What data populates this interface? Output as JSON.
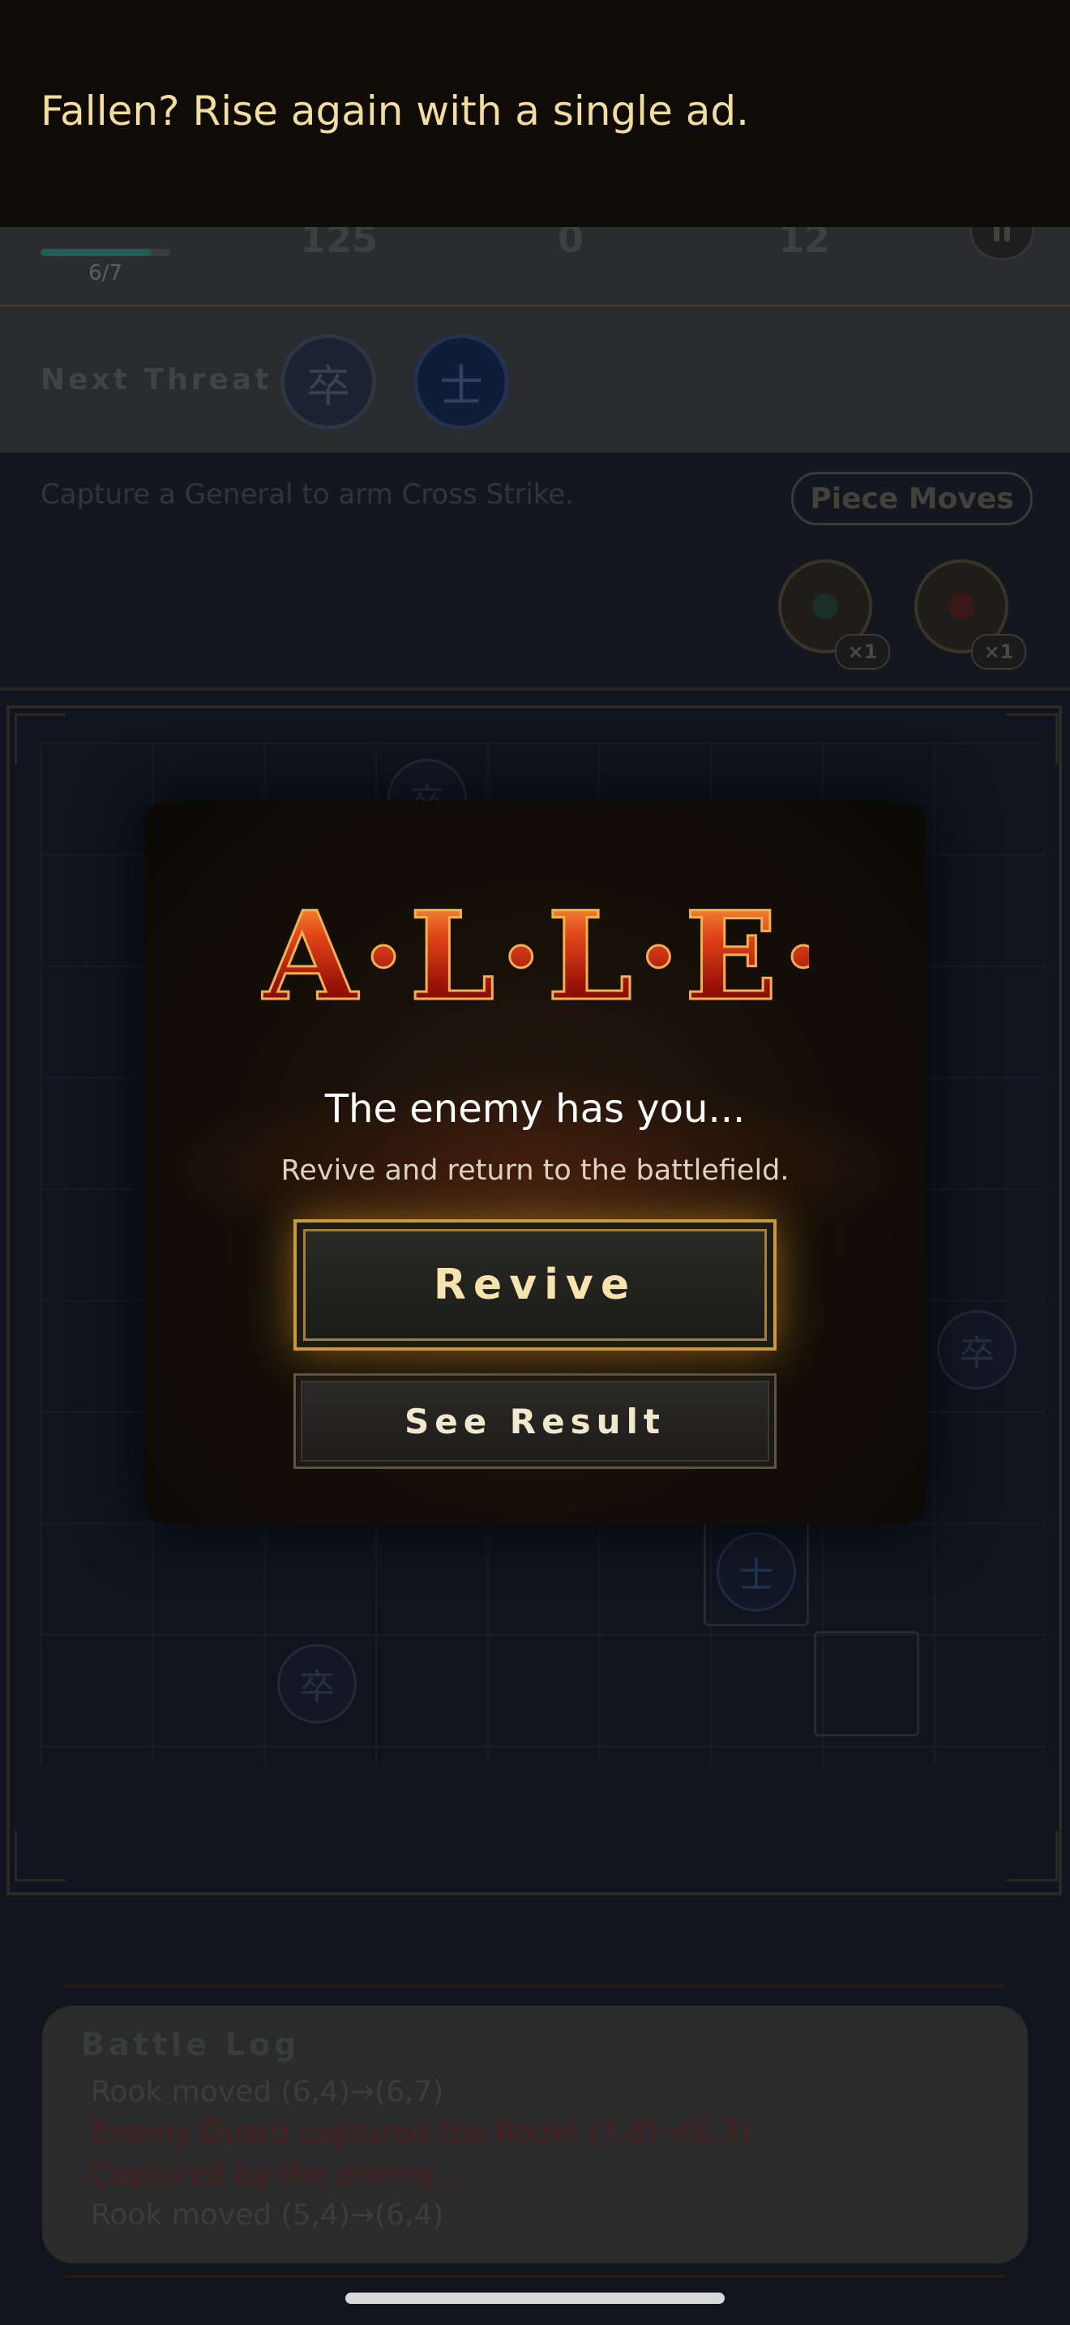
{
  "ad_banner": {
    "text": "Fallen? Rise again with a single ad."
  },
  "header": {
    "hp_text": "6/7",
    "hp_fraction": 0.857,
    "stats": [
      "125",
      "0",
      "12"
    ]
  },
  "threat": {
    "label": "Next Threat",
    "pieces": [
      "卒",
      "士"
    ]
  },
  "hint": {
    "text": "Capture a General to arm Cross Strike.",
    "moves_button": "Piece Moves"
  },
  "powerups": [
    {
      "count": "×1",
      "icon": "jade-medallion-icon"
    },
    {
      "count": "×1",
      "icon": "crimson-medallion-icon"
    }
  ],
  "board": {
    "pieces": [
      "卒",
      "卒",
      "士",
      "卒"
    ]
  },
  "modal": {
    "logo_text": "FALLEN",
    "title": "The enemy has you...",
    "subtitle": "Revive and return to the battlefield.",
    "revive_label": "Revive",
    "result_label": "See Result"
  },
  "battle_log": {
    "title": "Battle Log",
    "entries": [
      {
        "text": "Rook moved (6,4)→(6,7)",
        "type": "normal"
      },
      {
        "text": "Enemy Guard captured the Rook! (7,8)→(6,7)",
        "type": "bad"
      },
      {
        "text": "Captured by the enemy...",
        "type": "bad"
      },
      {
        "text": "Rook moved (5,4)→(6,4)",
        "type": "normal"
      }
    ]
  },
  "colors": {
    "accent_gold": "#c99a3c",
    "danger_red": "#b3261e",
    "ad_text": "#f2dd9a"
  }
}
